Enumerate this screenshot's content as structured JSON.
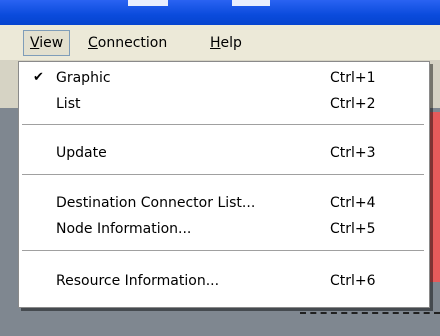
{
  "menubar": {
    "items": [
      {
        "label": "View",
        "accel": "V",
        "rest": "iew"
      },
      {
        "label": "Connection",
        "accel": "C",
        "rest": "onnection"
      },
      {
        "label": "Help",
        "accel": "H",
        "rest": "elp"
      }
    ]
  },
  "view_menu": {
    "items": [
      {
        "label": "Graphic",
        "shortcut": "Ctrl+1",
        "checked": true
      },
      {
        "label": "List",
        "shortcut": "Ctrl+2",
        "checked": false
      },
      {
        "label": "Update",
        "shortcut": "Ctrl+3",
        "checked": false
      },
      {
        "label": "Destination Connector List...",
        "shortcut": "Ctrl+4",
        "checked": false
      },
      {
        "label": "Node Information...",
        "shortcut": "Ctrl+5",
        "checked": false
      },
      {
        "label": "Resource Information...",
        "shortcut": "Ctrl+6",
        "checked": false
      }
    ],
    "check_glyph": "✔"
  },
  "colors": {
    "titlebar": "#0a4bdc",
    "menubar": "#ece9d8",
    "menu_bg": "#ffffff",
    "background": "#7f8790",
    "accent_red": "#e65b5b"
  }
}
